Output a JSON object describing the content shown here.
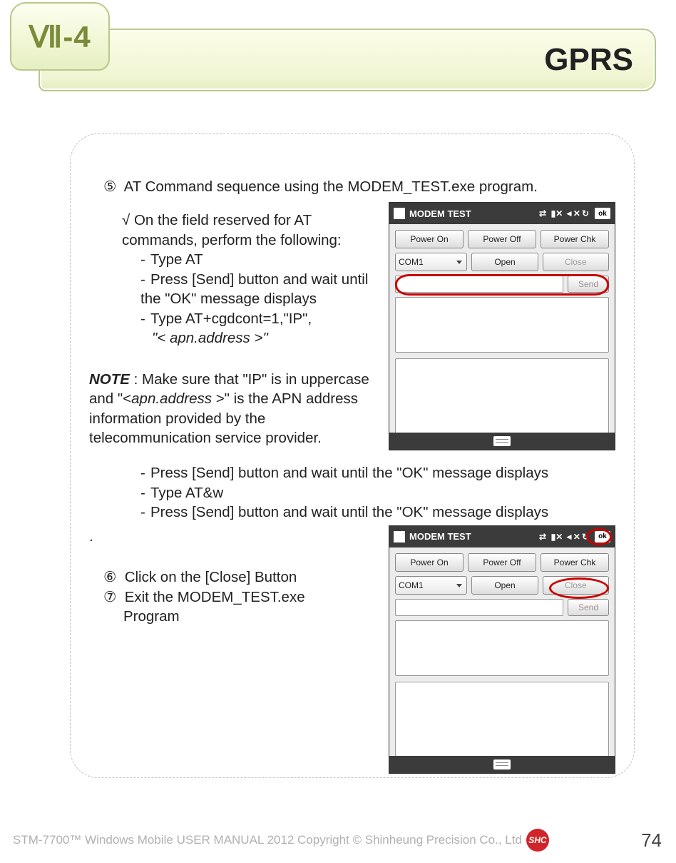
{
  "header": {
    "tab_label": "Ⅶ-4",
    "title": "GPRS"
  },
  "section5": {
    "num": "⑤",
    "heading": "AT Command sequence using the MODEM_TEST.exe program.",
    "check_line": "On the field reserved for AT commands, perform the following:",
    "items": [
      "Type AT",
      "Press [Send] button and wait until the \"OK\" message displays",
      "Type AT+cgdcont=1,\"IP\",",
      "\"< apn.address >\""
    ],
    "note_label": "NOTE",
    "note_text_1": " : Make sure that \"IP\" is in uppercase and \"<",
    "note_apn": "apn.address",
    "note_text_2": " >\" is the APN address information provided by the telecommunication service provider.",
    "after_items": [
      "Press [Send] button and wait until the \"OK\" message displays",
      "Type AT&w",
      "Press [Send] button and wait until the \"OK\" message displays"
    ]
  },
  "period": ".",
  "section6": {
    "num": "⑥",
    "text": "Click on the [Close] Button"
  },
  "section7": {
    "num": "⑦",
    "line1": "Exit the MODEM_TEST.exe",
    "line2": "Program"
  },
  "modem": {
    "title": "MODEM TEST",
    "status_icons": [
      "sig",
      "ant",
      "spk",
      "sync"
    ],
    "ok_label": "ok",
    "buttons": {
      "power_on": "Power On",
      "power_off": "Power Off",
      "power_chk": "Power Chk",
      "open": "Open",
      "close": "Close",
      "send": "Send"
    },
    "combo_value": "COM1"
  },
  "footer": {
    "text": "STM-7700™ Windows Mobile USER MANUAL  2012 Copyright © Shinheung Precision Co., Ltd",
    "logo": "SHC",
    "page": "74"
  }
}
